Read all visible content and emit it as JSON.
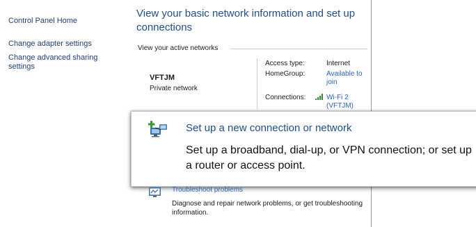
{
  "sidebar": {
    "items": [
      {
        "label": "Control Panel Home"
      },
      {
        "label": "Change adapter settings"
      },
      {
        "label": "Change advanced sharing settings"
      }
    ]
  },
  "main": {
    "title": "View your basic network information and set up connections",
    "active_networks_label": "View your active networks",
    "network": {
      "name": "VFTJM",
      "type": "Private network",
      "access_type_label": "Access type:",
      "access_type_value": "Internet",
      "homegroup_label": "HomeGroup:",
      "homegroup_value": "Available to join",
      "connections_label": "Connections:",
      "connections_value": "Wi-Fi 2 (VFTJM)"
    }
  },
  "callout": {
    "icon": "new-connection-icon",
    "title": "Set up a new connection or network",
    "description": "Set up a broadband, dial-up, or VPN connection; or set up a router or access point."
  },
  "troubleshoot": {
    "icon": "troubleshoot-icon",
    "title": "Troubleshoot problems",
    "description": "Diagnose and repair network problems, or get troubleshooting information."
  },
  "colors": {
    "link": "#2a62b8",
    "title": "#1e4e8c",
    "nav": "#1f3f73"
  }
}
